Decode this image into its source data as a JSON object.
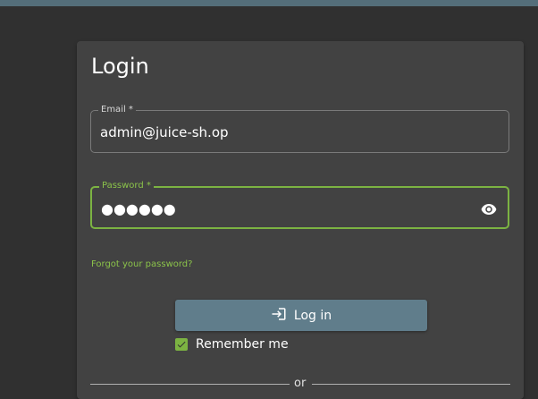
{
  "login": {
    "title": "Login",
    "email_label": "Email *",
    "email_value": "admin@juice-sh.op",
    "password_label": "Password *",
    "password_value": "●●●●●●",
    "forgot_link": "Forgot your password?",
    "login_button_label": "Log in",
    "remember_me_label": "Remember me",
    "remember_me_checked": true,
    "divider_text": "or"
  },
  "icons": {
    "password_toggle": "eye-icon",
    "login": "login-icon",
    "checkbox": "check-icon"
  },
  "colors": {
    "background": "#303030",
    "card": "#424242",
    "accent": "#7cb342",
    "button": "#607d8b",
    "topbar": "#546e7a"
  }
}
